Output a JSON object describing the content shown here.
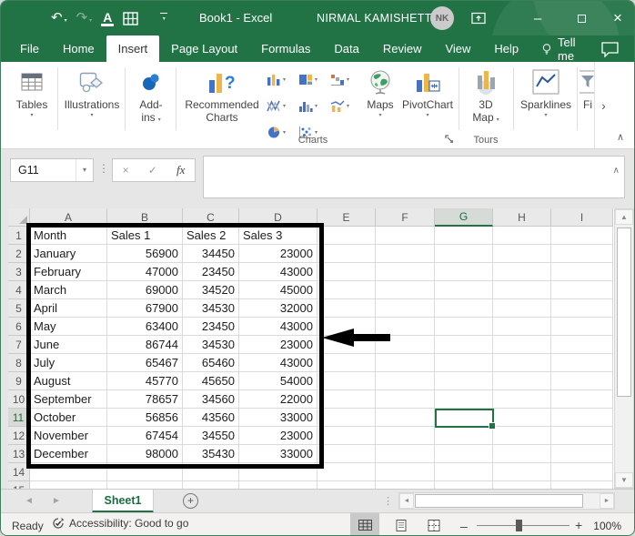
{
  "window": {
    "title": "Book1 - Excel",
    "user": "NIRMAL KAMISHETTY",
    "avatar": "NK"
  },
  "icons": {
    "undo": "↶",
    "redo": "↷",
    "dropdown": "▾",
    "minimize": "–",
    "close": "×",
    "cancel": "×",
    "enter": "✓",
    "function": "fx",
    "more-dots": "⋮",
    "scroll-up": "▲",
    "scroll-down": "▼",
    "scroll-left": "◄",
    "scroll-right": "►",
    "sheet-prev": "◄",
    "sheet-next": "►",
    "ribbon-scroll": "›",
    "chevron-up": "∧",
    "zoom-out": "–",
    "zoom-in": "+",
    "add-sheet": "+"
  },
  "tabs": [
    {
      "label": "File",
      "active": false
    },
    {
      "label": "Home",
      "active": false
    },
    {
      "label": "Insert",
      "active": true
    },
    {
      "label": "Page Layout",
      "active": false
    },
    {
      "label": "Formulas",
      "active": false
    },
    {
      "label": "Data",
      "active": false
    },
    {
      "label": "Review",
      "active": false
    },
    {
      "label": "View",
      "active": false
    },
    {
      "label": "Help",
      "active": false
    }
  ],
  "tellme": "Tell me",
  "ribbon": {
    "tables": "Tables",
    "illustrations": "Illustrations",
    "addins_line1": "Add-",
    "addins_line2": "ins",
    "recommended_line1": "Recommended",
    "recommended_line2": "Charts",
    "charts_group": "Charts",
    "maps": "Maps",
    "pivotchart": "PivotChart",
    "map3d_line1": "3D",
    "map3d_line2": "Map",
    "tours_group": "Tours",
    "sparklines": "Sparklines",
    "filters_partial": "Fi"
  },
  "formula": {
    "name_box": "G11",
    "value": ""
  },
  "sheet": {
    "columns": [
      "A",
      "B",
      "C",
      "D",
      "E",
      "F",
      "G",
      "H",
      "I"
    ],
    "visible_row_count": 15,
    "selected_cell": "G11",
    "selected_column": "G",
    "selected_row": 11,
    "table": {
      "range": "A1:D13",
      "headers": [
        "Month",
        "Sales 1",
        "Sales 2",
        "Sales 3"
      ],
      "rows": [
        [
          "January",
          56900,
          34450,
          23000
        ],
        [
          "February",
          47000,
          23450,
          43000
        ],
        [
          "March",
          69000,
          34520,
          45000
        ],
        [
          "April",
          67900,
          34530,
          32000
        ],
        [
          "May",
          63400,
          23450,
          43000
        ],
        [
          "June",
          86744,
          34530,
          23000
        ],
        [
          "July",
          65467,
          65460,
          43000
        ],
        [
          "August",
          45770,
          45650,
          54000
        ],
        [
          "September",
          78657,
          34560,
          22000
        ],
        [
          "October",
          56856,
          43560,
          33000
        ],
        [
          "November",
          67454,
          34550,
          23000
        ],
        [
          "December",
          98000,
          35430,
          33000
        ]
      ]
    }
  },
  "sheet_tabs": {
    "active": "Sheet1"
  },
  "status": {
    "mode": "Ready",
    "accessibility": "Accessibility: Good to go",
    "zoom_level": "100%"
  },
  "colors": {
    "brand": "#217346",
    "selection": "#217346",
    "table_border": "#000000"
  }
}
